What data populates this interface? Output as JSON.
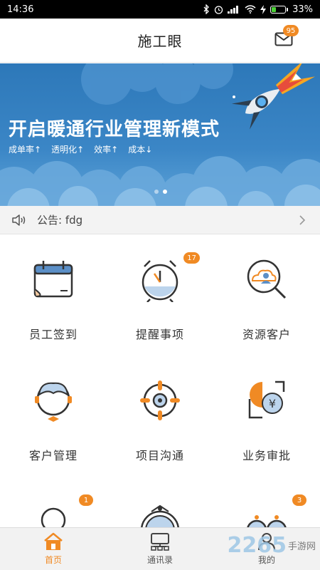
{
  "status_bar": {
    "time": "14:36",
    "battery": "33%",
    "battery_level": 0.33
  },
  "header": {
    "title": "施工眼",
    "mail_badge": "95"
  },
  "banner": {
    "headline": "开启暖通行业管理新模式",
    "tags": [
      "成单率↑",
      "透明化↑",
      "效率↑",
      "成本↓"
    ],
    "page_count": 2,
    "active_page": 2
  },
  "notice": {
    "label": "公告: fdg"
  },
  "grid": {
    "items": [
      {
        "label": "员工签到",
        "icon": "calendar-icon",
        "badge": ""
      },
      {
        "label": "提醒事项",
        "icon": "alarm-clock-icon",
        "badge": "17"
      },
      {
        "label": "资源客户",
        "icon": "search-customer-icon",
        "badge": ""
      },
      {
        "label": "客户管理",
        "icon": "customer-avatar-icon",
        "badge": ""
      },
      {
        "label": "项目沟通",
        "icon": "target-icon",
        "badge": ""
      },
      {
        "label": "业务审批",
        "icon": "approval-yen-icon",
        "badge": ""
      },
      {
        "label": "",
        "icon": "person-icon",
        "badge": "1"
      },
      {
        "label": "",
        "icon": "clock-icon",
        "badge": ""
      },
      {
        "label": "",
        "icon": "glasses-icon",
        "badge": "3"
      }
    ]
  },
  "tabbar": {
    "tabs": [
      {
        "label": "首页",
        "icon": "home-icon",
        "active": true
      },
      {
        "label": "通讯录",
        "icon": "contacts-icon",
        "active": false
      },
      {
        "label": "我的",
        "icon": "profile-icon",
        "active": false
      }
    ]
  },
  "watermark": {
    "number": "2265",
    "text": "手游网"
  },
  "colors": {
    "accent": "#f08a24",
    "banner_blue": "#2d78b9",
    "icon_line": "#333333",
    "icon_blue": "#5b8fc7"
  }
}
